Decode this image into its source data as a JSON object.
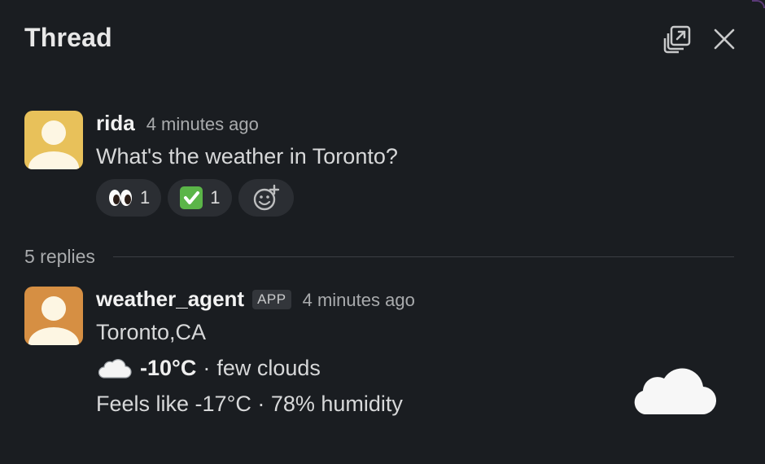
{
  "header": {
    "title": "Thread",
    "icons": [
      "popout-icon",
      "close-icon"
    ]
  },
  "parent_message": {
    "author": "rida",
    "time": "4 minutes ago",
    "text": "What's the weather in Toronto?",
    "avatar_color": "#e8c15a",
    "reactions": [
      {
        "emoji": "eyes",
        "count": "1"
      },
      {
        "emoji": "white-check-mark",
        "count": "1"
      }
    ],
    "add_reaction_icon": "add-reaction-icon"
  },
  "replies": {
    "count_label": "5 replies"
  },
  "reply_message": {
    "author": "weather_agent",
    "badge": "APP",
    "time": "4 minutes ago",
    "avatar_color": "#d68f43",
    "location": "Toronto,CA",
    "temperature": "-10°C",
    "separator": "·",
    "condition": "few clouds",
    "details": "Feels like -17°C · 78% humidity",
    "icon": "cloud-icon"
  },
  "colors": {
    "background": "#1a1d21",
    "reaction_bg": "#2b2e33",
    "divider": "#3b3e43"
  }
}
